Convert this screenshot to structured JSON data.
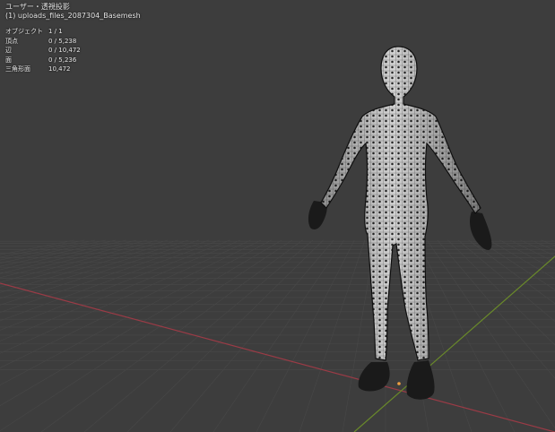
{
  "viewport": {
    "view_title": "ユーザー・透視投影",
    "object_name": "(1) uploads_files_2087304_Basemesh"
  },
  "stats": [
    {
      "label": "オブジェクト",
      "value": "1 / 1"
    },
    {
      "label": "頂点",
      "value": "0 / 5,238"
    },
    {
      "label": "辺",
      "value": "0 / 10,472"
    },
    {
      "label": "面",
      "value": "0 / 5,236"
    },
    {
      "label": "三角形面",
      "value": "10,472"
    }
  ],
  "colors": {
    "background": "#3d3d3d",
    "grid": "#484848",
    "x_axis": "#9a3b46",
    "y_axis": "#6a8a2a",
    "mesh_fill": "#c8c8c8",
    "mesh_vertex": "#111111"
  }
}
